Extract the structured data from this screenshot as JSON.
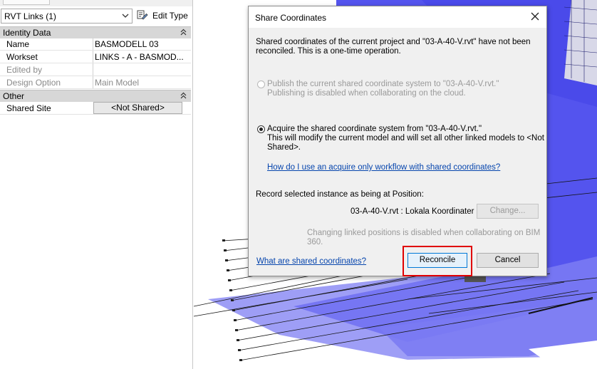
{
  "properties": {
    "type_selector": "RVT Links (1)",
    "edit_type_label": "Edit Type",
    "groups": {
      "identity": "Identity Data",
      "other": "Other"
    },
    "rows": {
      "name": {
        "key": "Name",
        "value": "BASMODELL 03"
      },
      "workset": {
        "key": "Workset",
        "value": "LINKS - A - BASMOD..."
      },
      "edited_by": {
        "key": "Edited by",
        "value": ""
      },
      "design_option": {
        "key": "Design Option",
        "value": "Main Model"
      },
      "shared_site": {
        "key": "Shared Site",
        "value": "<Not Shared>"
      }
    }
  },
  "dialog": {
    "title": "Share Coordinates",
    "intro_line1": "Shared coordinates of the current project and \"03-A-40-V.rvt\" have not been",
    "intro_line2": "reconciled. This is a one-time operation.",
    "publish_label": "Publish the current shared coordinate system to \"03-A-40-V.rvt.\"",
    "publish_note": "Publishing is disabled when collaborating on the cloud.",
    "acquire_label": "Acquire the shared coordinate system from \"03-A-40-V.rvt.\"",
    "acquire_note_line1": "This will modify the current model and will set all other linked models to <Not",
    "acquire_note_line2": "Shared>.",
    "acquire_help_link": "How do I use an acquire only workflow with shared coordinates?",
    "record_label": "Record selected instance as being at Position:",
    "position_value": "03-A-40-V.rvt : Lokala Koordinater",
    "change_button": "Change...",
    "disabled_note": "Changing linked positions is disabled when collaborating on BIM 360.",
    "help_link": "What are shared coordinates?",
    "reconcile_button": "Reconcile",
    "cancel_button": "Cancel",
    "selected_option": "acquire"
  },
  "colors": {
    "model_blue": "#5c5cf0",
    "highlight_red": "#e00000",
    "link_blue": "#0645ad"
  }
}
